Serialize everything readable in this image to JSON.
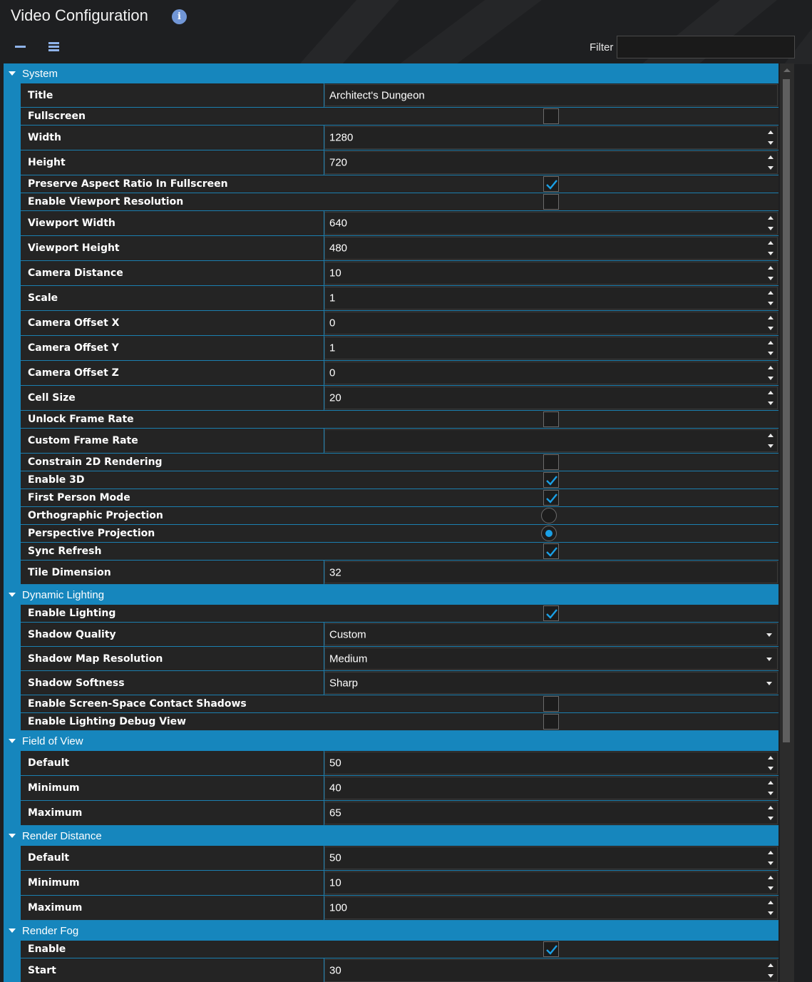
{
  "header": {
    "title": "Video Configuration",
    "info_icon": "info-icon",
    "filter_label": "Filter",
    "filter_value": "",
    "filter_placeholder": ""
  },
  "colors": {
    "accent": "#1686bd",
    "check": "#1aa0e6",
    "background": "#1e1f21",
    "row": "#242424"
  },
  "categories": [
    {
      "id": "system",
      "label": "System",
      "rows": [
        {
          "id": "title",
          "label": "Title",
          "type": "text",
          "value": "Architect's Dungeon"
        },
        {
          "id": "fullscreen",
          "label": "Fullscreen",
          "type": "check",
          "checked": false
        },
        {
          "id": "width",
          "label": "Width",
          "type": "number",
          "value": "1280"
        },
        {
          "id": "height",
          "label": "Height",
          "type": "number",
          "value": "720"
        },
        {
          "id": "preserve-aspect",
          "label": "Preserve Aspect Ratio In Fullscreen",
          "type": "check",
          "checked": true
        },
        {
          "id": "enable-viewport-resolution",
          "label": "Enable Viewport Resolution",
          "type": "check",
          "checked": false
        },
        {
          "id": "viewport-width",
          "label": "Viewport Width",
          "type": "number",
          "value": "640"
        },
        {
          "id": "viewport-height",
          "label": "Viewport Height",
          "type": "number",
          "value": "480"
        },
        {
          "id": "camera-distance",
          "label": "Camera Distance",
          "type": "number",
          "value": "10"
        },
        {
          "id": "scale",
          "label": "Scale",
          "type": "number",
          "value": "1"
        },
        {
          "id": "camera-offset-x",
          "label": "Camera Offset X",
          "type": "number",
          "value": "0"
        },
        {
          "id": "camera-offset-y",
          "label": "Camera Offset Y",
          "type": "number",
          "value": "1"
        },
        {
          "id": "camera-offset-z",
          "label": "Camera Offset Z",
          "type": "number",
          "value": "0"
        },
        {
          "id": "cell-size",
          "label": "Cell Size",
          "type": "number",
          "value": "20"
        },
        {
          "id": "unlock-frame-rate",
          "label": "Unlock Frame Rate",
          "type": "check",
          "checked": false
        },
        {
          "id": "custom-frame-rate",
          "label": "Custom Frame Rate",
          "type": "number",
          "value": ""
        },
        {
          "id": "constrain-2d",
          "label": "Constrain 2D Rendering",
          "type": "check",
          "checked": false
        },
        {
          "id": "enable-3d",
          "label": "Enable 3D",
          "type": "check",
          "checked": true
        },
        {
          "id": "first-person",
          "label": "First Person Mode",
          "type": "check",
          "checked": true
        },
        {
          "id": "orthographic",
          "label": "Orthographic Projection",
          "type": "radio",
          "checked": false
        },
        {
          "id": "perspective",
          "label": "Perspective Projection",
          "type": "radio",
          "checked": true
        },
        {
          "id": "sync-refresh",
          "label": "Sync Refresh",
          "type": "check",
          "checked": true
        },
        {
          "id": "tile-dimension",
          "label": "Tile Dimension",
          "type": "text",
          "value": "32"
        }
      ]
    },
    {
      "id": "dynamic-lighting",
      "label": "Dynamic Lighting",
      "rows": [
        {
          "id": "enable-lighting",
          "label": "Enable Lighting",
          "type": "check",
          "checked": true
        },
        {
          "id": "shadow-quality",
          "label": "Shadow Quality",
          "type": "select",
          "value": "Custom"
        },
        {
          "id": "shadow-map-resolution",
          "label": "Shadow Map Resolution",
          "type": "select",
          "value": "Medium"
        },
        {
          "id": "shadow-softness",
          "label": "Shadow Softness",
          "type": "select",
          "value": "Sharp"
        },
        {
          "id": "screen-space-contact-shadows",
          "label": "Enable Screen-Space Contact Shadows",
          "type": "check",
          "checked": false
        },
        {
          "id": "lighting-debug-view",
          "label": "Enable Lighting Debug View",
          "type": "check",
          "checked": false
        }
      ]
    },
    {
      "id": "field-of-view",
      "label": "Field of View",
      "rows": [
        {
          "id": "fov-default",
          "label": "Default",
          "type": "number",
          "value": "50"
        },
        {
          "id": "fov-minimum",
          "label": "Minimum",
          "type": "number",
          "value": "40"
        },
        {
          "id": "fov-maximum",
          "label": "Maximum",
          "type": "number",
          "value": "65"
        }
      ]
    },
    {
      "id": "render-distance",
      "label": "Render Distance",
      "rows": [
        {
          "id": "rd-default",
          "label": "Default",
          "type": "number",
          "value": "50"
        },
        {
          "id": "rd-minimum",
          "label": "Minimum",
          "type": "number",
          "value": "10"
        },
        {
          "id": "rd-maximum",
          "label": "Maximum",
          "type": "number",
          "value": "100"
        }
      ]
    },
    {
      "id": "render-fog",
      "label": "Render Fog",
      "rows": [
        {
          "id": "fog-enable",
          "label": "Enable",
          "type": "check",
          "checked": true
        },
        {
          "id": "fog-start",
          "label": "Start",
          "type": "number",
          "value": "30"
        },
        {
          "id": "fog-end",
          "label": "",
          "type": "number",
          "value": ""
        }
      ]
    }
  ]
}
